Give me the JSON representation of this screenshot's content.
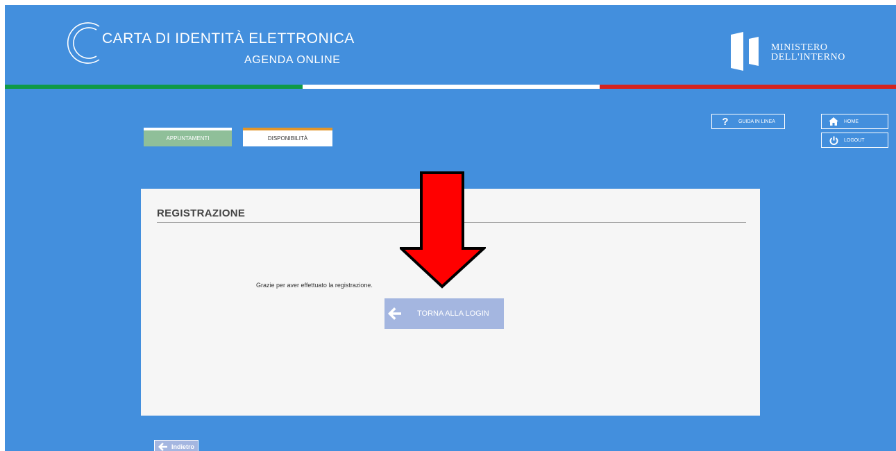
{
  "header": {
    "title_main": "CARTA DI IDENTITÀ ELETTRONICA",
    "title_sub": "AGENDA ONLINE",
    "ministry_line1": "MINISTERO",
    "ministry_line2": "DELL'INTERNO"
  },
  "colors": {
    "background": "#438fdd",
    "flag_green": "#0f9a47",
    "flag_white": "#ffffff",
    "flag_red": "#d5231e",
    "tab_appuntamenti": "#8fbf99",
    "tab_disponibilita_accent": "#e2962a",
    "button_light": "#a4b6e0",
    "annotation_arrow": "#ff0000"
  },
  "nav": {
    "appuntamenti": "APPUNTAMENTI",
    "disponibilita": "DISPONIBILITÀ"
  },
  "top_buttons": {
    "guida": {
      "label": "GUIDA IN LINEA",
      "icon": "question-icon"
    },
    "home": {
      "label": "HOME",
      "icon": "home-icon"
    },
    "logout": {
      "label": "LOGOUT",
      "icon": "power-icon"
    }
  },
  "card": {
    "title": "REGISTRAZIONE",
    "message": "Grazie per aver effettuato la registrazione.",
    "torna_button": "TORNA ALLA LOGIN"
  },
  "footer": {
    "indietro_button": "Indietro"
  },
  "annotation": {
    "icon": "red-down-arrow-icon"
  }
}
